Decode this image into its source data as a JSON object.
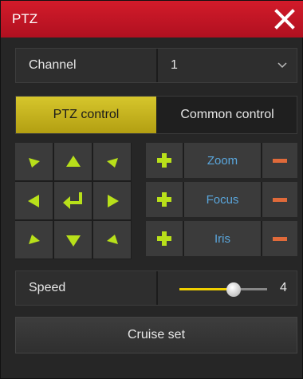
{
  "window": {
    "title": "PTZ"
  },
  "channel": {
    "label": "Channel",
    "value": "1"
  },
  "tabs": [
    {
      "label": "PTZ control",
      "active": true
    },
    {
      "label": "Common control",
      "active": false
    }
  ],
  "controls": [
    {
      "name": "Zoom"
    },
    {
      "name": "Focus"
    },
    {
      "name": "Iris"
    }
  ],
  "speed": {
    "label": "Speed",
    "value": "4",
    "fraction": 0.62
  },
  "cruise": {
    "label": "Cruise set"
  },
  "colors": {
    "titlebar": "#c8152a",
    "active_tab": "#c9b81f",
    "arrow": "#b8e01a",
    "control_text": "#5aa6dc",
    "minus": "#e06a3a",
    "slider": "#f0d000"
  },
  "icons": [
    "close-icon",
    "chevron-down-icon",
    "arrow-up-icon",
    "arrow-down-icon",
    "arrow-left-icon",
    "arrow-right-icon",
    "arrow-up-left-icon",
    "arrow-up-right-icon",
    "arrow-down-left-icon",
    "arrow-down-right-icon",
    "return-icon",
    "plus-icon",
    "minus-icon",
    "slider-thumb-icon"
  ]
}
